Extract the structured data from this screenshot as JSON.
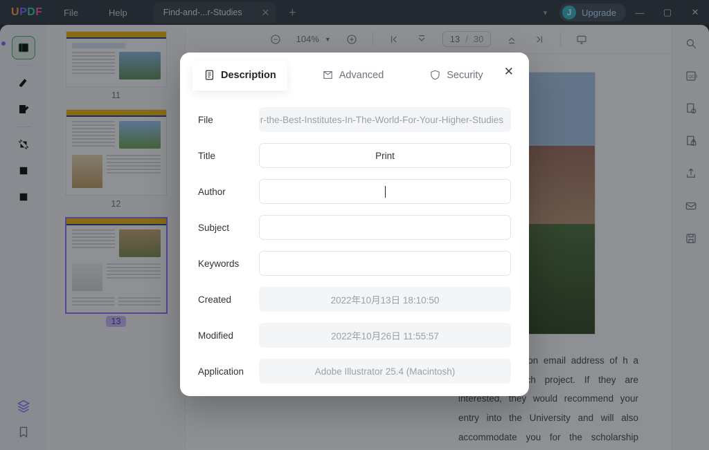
{
  "titlebar": {
    "logo_letters": [
      "U",
      "P",
      "D",
      "F"
    ],
    "menu_file": "File",
    "menu_help": "Help",
    "tab_label": "Find-and-...r-Studies",
    "upgrade_label": "Upgrade",
    "avatar_initial": "J"
  },
  "left_rail": {
    "icons": [
      "panel-icon",
      "highlighter-icon",
      "edit-text-icon",
      "crop-icon",
      "rotate-icon",
      "refresh-icon"
    ],
    "bottom_icons": [
      "layers-icon",
      "bookmark-icon"
    ]
  },
  "thumbnails": [
    {
      "num": "11",
      "selected": false
    },
    {
      "num": "12",
      "selected": false
    },
    {
      "num": "13",
      "selected": true
    }
  ],
  "toolbar": {
    "zoom_value": "104%",
    "page_current": "13",
    "page_sep": "/",
    "page_total": "30"
  },
  "document": {
    "body_text": "r a contact option email address of h a proper appli- ch project. If they are interested, they would recommend your entry into the University and will also accommo­date you for the scholarship program."
  },
  "right_rail": {
    "icons": [
      "search-icon",
      "ocr-icon",
      "page-gear-icon",
      "encrypt-icon",
      "share-icon",
      "mail-icon",
      "save-icon"
    ]
  },
  "modal": {
    "tabs": {
      "description": "Description",
      "advanced": "Advanced",
      "security": "Security"
    },
    "rows": {
      "file_label": "File",
      "file_value": "y-For-the-Best-Institutes-In-The-World-For-Your-Higher-Studies",
      "title_label": "Title",
      "title_value": "Print",
      "author_label": "Author",
      "author_value": "",
      "subject_label": "Subject",
      "subject_value": "",
      "keywords_label": "Keywords",
      "keywords_value": "",
      "created_label": "Created",
      "created_value": "2022年10月13日 18:10:50",
      "modified_label": "Modified",
      "modified_value": "2022年10月26日 11:55:57",
      "application_label": "Application",
      "application_value": "Adobe Illustrator 25.4 (Macintosh)"
    }
  }
}
